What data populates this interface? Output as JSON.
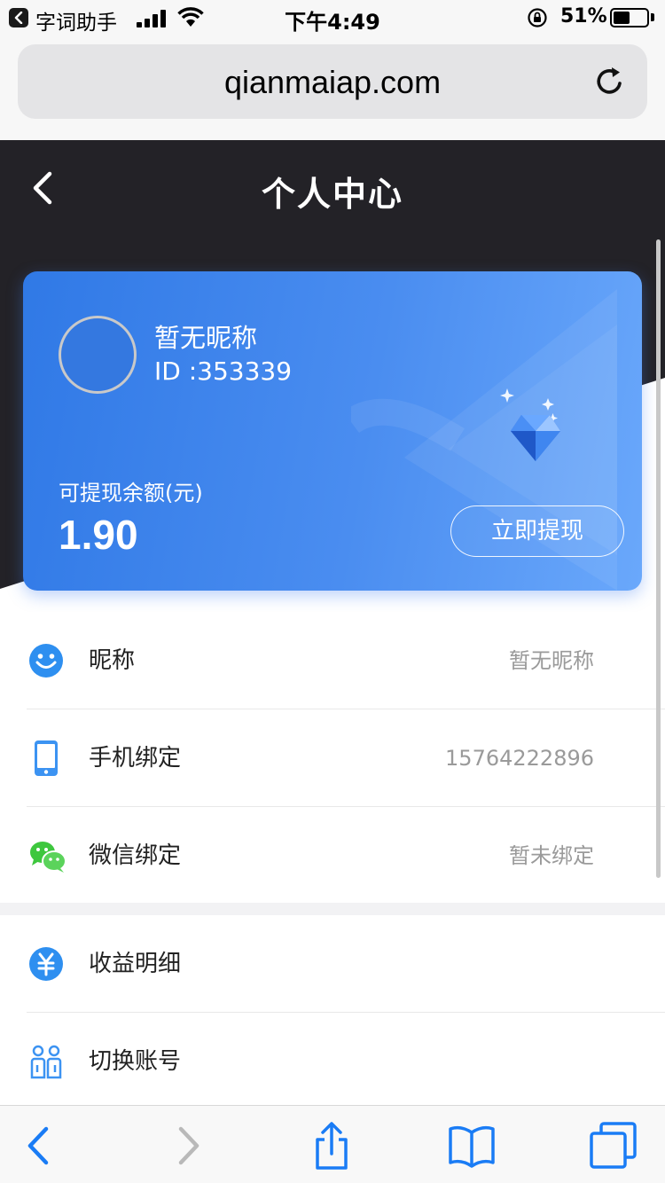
{
  "status_bar": {
    "app_name": "字词助手",
    "time": "下午4:49",
    "battery_percent_text": "51%",
    "battery_level": 0.51
  },
  "browser": {
    "url": "qianmaiap.com"
  },
  "header": {
    "title": "个人中心"
  },
  "user_card": {
    "nickname": "暂无昵称",
    "user_id": "ID :353339",
    "balance_label": "可提现余额(元)",
    "balance_value": "1.90",
    "withdraw_label": "立即提现"
  },
  "account_list": [
    {
      "icon": "smiley-icon",
      "label": "昵称",
      "value": "暂无昵称"
    },
    {
      "icon": "phone-icon",
      "label": "手机绑定",
      "value": "15764222896"
    },
    {
      "icon": "wechat-icon",
      "label": "微信绑定",
      "value": "暂未绑定"
    }
  ],
  "action_list": [
    {
      "icon": "yuan-icon",
      "label": "收益明细"
    },
    {
      "icon": "switch-account-icon",
      "label": "切换账号"
    }
  ],
  "colors": {
    "header_bg": "#232227",
    "card_blue": "#3079e6",
    "icon_blue": "#2e8ff0",
    "wechat_green": "#3ec73e"
  }
}
